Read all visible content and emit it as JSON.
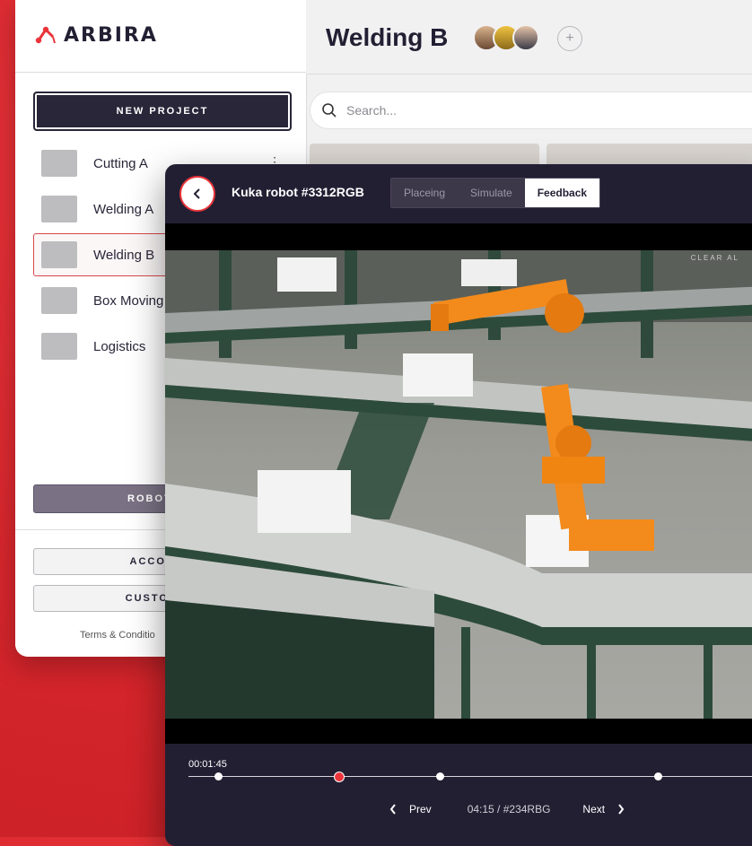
{
  "app": {
    "logo_text": "ARBIRA"
  },
  "sidebar": {
    "new_project_label": "NEW PROJECT",
    "projects": [
      {
        "name": "Cutting A"
      },
      {
        "name": "Welding A"
      },
      {
        "name": "Welding B",
        "active": true
      },
      {
        "name": "Box Moving"
      },
      {
        "name": "Logistics"
      }
    ],
    "robot_button_label": "ROBOT MA",
    "account_label": "ACCOUNT",
    "customer_label": "CUSTOMER",
    "terms_text": "Terms & Conditio"
  },
  "main": {
    "title": "Welding B",
    "search_placeholder": "Search..."
  },
  "overlay": {
    "title": "Kuka robot #3312RGB",
    "tabs": [
      {
        "label": "Placeing"
      },
      {
        "label": "Simulate"
      },
      {
        "label": "Feedback",
        "active": true
      }
    ],
    "clear_all": "CLEAR AL",
    "timecode": "00:01:45",
    "prev_label": "Prev",
    "position_text": "04:15 / #234RBG",
    "next_label": "Next"
  },
  "colors": {
    "brand_red": "#e9353b",
    "dark_navy": "#231f33",
    "robot_orange": "#f28a1c"
  }
}
